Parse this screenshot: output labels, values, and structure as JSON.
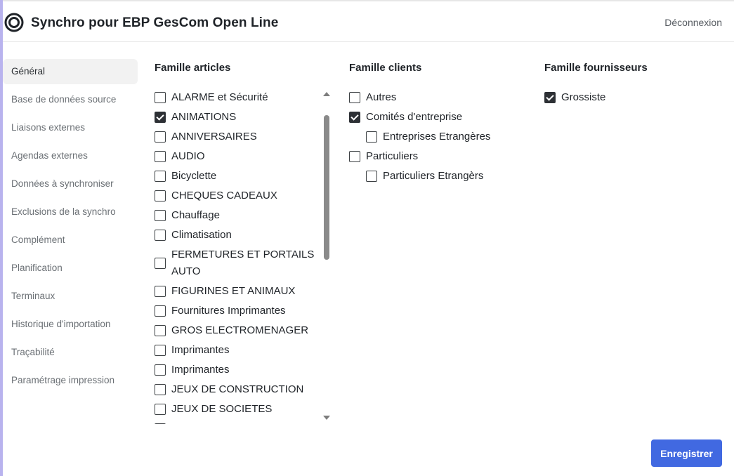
{
  "header": {
    "app_title": "Synchro pour EBP GesCom Open Line",
    "logout_label": "Déconnexion",
    "logo_icon": "ring-logo-icon"
  },
  "sidebar": {
    "items": [
      {
        "label": "Général",
        "active": true
      },
      {
        "label": "Base de données source"
      },
      {
        "label": "Liaisons externes"
      },
      {
        "label": "Agendas externes"
      },
      {
        "label": "Données à synchroniser"
      },
      {
        "label": "Exclusions de la synchro"
      },
      {
        "label": "Complément"
      },
      {
        "label": "Planification"
      },
      {
        "label": "Terminaux"
      },
      {
        "label": "Historique d'importation"
      },
      {
        "label": "Traçabilité"
      },
      {
        "label": "Paramétrage impression"
      }
    ]
  },
  "articles": {
    "title": "Famille articles",
    "items": [
      {
        "label": "ALARME et Sécurité",
        "checked": false
      },
      {
        "label": "ANIMATIONS",
        "checked": true
      },
      {
        "label": "ANNIVERSAIRES",
        "checked": false
      },
      {
        "label": "AUDIO",
        "checked": false
      },
      {
        "label": "Bicyclette",
        "checked": false
      },
      {
        "label": "CHEQUES CADEAUX",
        "checked": false
      },
      {
        "label": "Chauffage",
        "checked": false
      },
      {
        "label": "Climatisation",
        "checked": false
      },
      {
        "label": "FERMETURES ET PORTAILS AUTO",
        "checked": false
      },
      {
        "label": "FIGURINES ET ANIMAUX",
        "checked": false
      },
      {
        "label": "Fournitures Imprimantes",
        "checked": false
      },
      {
        "label": "GROS ELECTROMENAGER",
        "checked": false
      },
      {
        "label": "Imprimantes",
        "checked": false
      },
      {
        "label": "Imprimantes",
        "checked": false
      },
      {
        "label": "JEUX DE CONSTRUCTION",
        "checked": false
      },
      {
        "label": "JEUX DE SOCIETES",
        "checked": false
      },
      {
        "label": "",
        "checked": false
      }
    ]
  },
  "clients": {
    "title": "Famille clients",
    "items": [
      {
        "label": "Autres",
        "checked": false,
        "level": 0
      },
      {
        "label": "Comités d'entreprise",
        "checked": true,
        "level": 0
      },
      {
        "label": "Entreprises Etrangères",
        "checked": false,
        "level": 1
      },
      {
        "label": "Particuliers",
        "checked": false,
        "level": 0
      },
      {
        "label": "Particuliers Etrangèrs",
        "checked": false,
        "level": 1
      }
    ]
  },
  "fournisseurs": {
    "title": "Famille fournisseurs",
    "items": [
      {
        "label": "Grossiste",
        "checked": true,
        "level": 0
      }
    ]
  },
  "footer": {
    "save_label": "Enregistrer"
  },
  "colors": {
    "accent": "#4169e1",
    "checked": "#2d3035",
    "active_nav_bg": "#f2f2f2",
    "left_edge": "#b9b3ee"
  }
}
